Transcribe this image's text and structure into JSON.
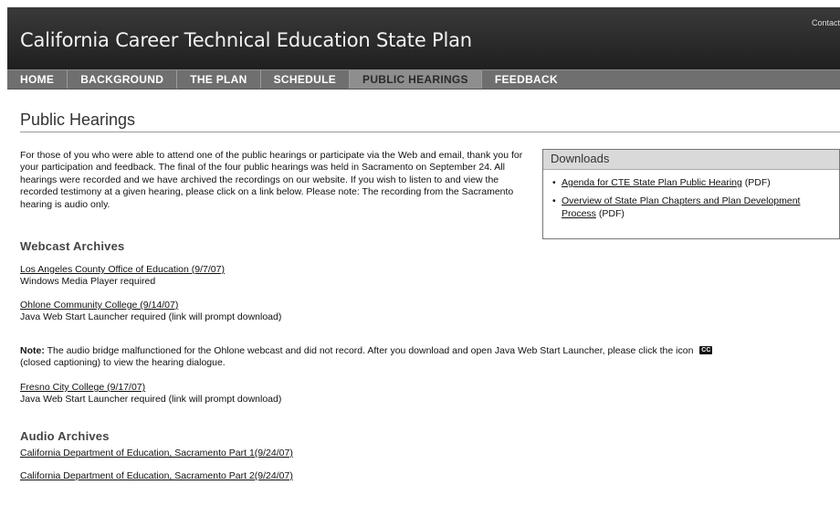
{
  "header": {
    "site_title": "California Career Technical Education State Plan",
    "contact": "Contact"
  },
  "nav": {
    "items": [
      {
        "label": "HOME"
      },
      {
        "label": "BACKGROUND"
      },
      {
        "label": "THE PLAN"
      },
      {
        "label": "SCHEDULE"
      },
      {
        "label": "PUBLIC HEARINGS",
        "active": true
      },
      {
        "label": "FEEDBACK"
      }
    ]
  },
  "page": {
    "title": "Public Hearings",
    "intro": "For those of you who were able to attend one of the public hearings or participate via the Web and email, thank you for your participation and feedback. The final of the four public hearings was held in Sacramento on September 24. All hearings were recorded and we have archived the recordings on our website. If you wish to listen to and view the recorded testimony at a given hearing, please click on a link below. Please note: The recording from the Sacramento hearing is audio only."
  },
  "downloads": {
    "heading": "Downloads",
    "items": [
      {
        "link": "Agenda for CTE State Plan Public Hearing",
        "suffix": " (PDF)"
      },
      {
        "link": "Overview of State Plan Chapters and Plan Development Process",
        "suffix": " (PDF)"
      }
    ]
  },
  "webcast": {
    "heading": "Webcast Archives",
    "entries": [
      {
        "link": "Los Angeles County Office of Education (9/7/07)",
        "note": "Windows Media Player required"
      },
      {
        "link": "Ohlone Community College (9/14/07)",
        "note": "Java Web Start Launcher required (link will prompt download)"
      },
      {
        "link": "Fresno City College (9/17/07)",
        "note": "Java Web Start Launcher required (link will prompt download)"
      }
    ],
    "note_label": "Note:",
    "note_text": " The audio bridge malfunctioned for the Ohlone webcast and did not record. After you download and open Java Web Start Launcher, please click the icon",
    "note_icon_text": "CC",
    "note_text_2": "(closed captioning) to view the hearing dialogue."
  },
  "audio": {
    "heading": "Audio Archives",
    "entries": [
      {
        "link": "California Department of Education, Sacramento Part 1(9/24/07)"
      },
      {
        "link": "California Department of Education, Sacramento Part 2(9/24/07)"
      }
    ]
  }
}
